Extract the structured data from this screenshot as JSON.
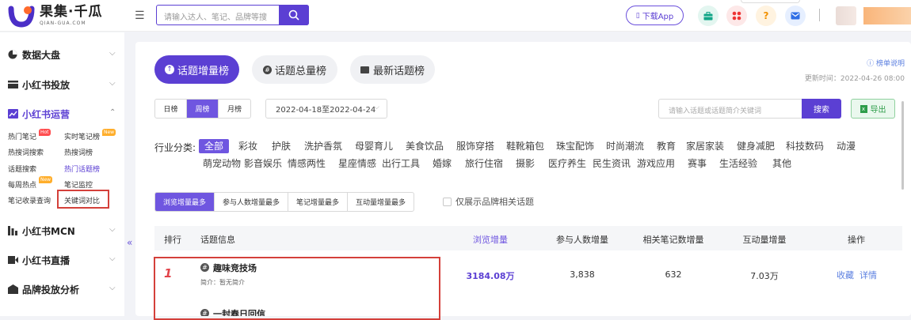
{
  "brand": {
    "name": "果集·千瓜",
    "sub": "QIAN-GUA.COM"
  },
  "topbar": {
    "search_placeholder": "请输入达人、笔记、品牌等搜",
    "download_label": "下载App",
    "icons": [
      "briefcase-icon",
      "apps-icon",
      "help-icon",
      "mail-icon"
    ]
  },
  "sidebar": {
    "sections": [
      {
        "label": "数据大盘",
        "icon": "pie-chart-icon",
        "expanded": false
      },
      {
        "label": "小红书投放",
        "icon": "folder-icon",
        "expanded": false
      },
      {
        "label": "小红书运营",
        "icon": "trend-chart-icon",
        "expanded": true
      },
      {
        "label": "小红书MCN",
        "icon": "mcn-icon",
        "expanded": false
      },
      {
        "label": "小红书直播",
        "icon": "live-icon",
        "expanded": false
      },
      {
        "label": "品牌投放分析",
        "icon": "brand-icon",
        "expanded": false
      }
    ],
    "links": [
      {
        "label": "热门笔记",
        "badge": "Hot"
      },
      {
        "label": "实时笔记榜",
        "badge": "New"
      },
      {
        "label": "热搜词搜索",
        "badge": ""
      },
      {
        "label": "热搜词榜",
        "badge": ""
      },
      {
        "label": "话题搜索",
        "badge": ""
      },
      {
        "label": "热门话题榜",
        "badge": "",
        "active": true
      },
      {
        "label": "每周热点",
        "badge": "New"
      },
      {
        "label": "笔记监控",
        "badge": ""
      },
      {
        "label": "笔记收录查询",
        "badge": ""
      },
      {
        "label": "关键词对比",
        "badge": ""
      }
    ],
    "collapse_glyph": "«"
  },
  "main": {
    "tabs": [
      {
        "label": "话题增量榜",
        "active": true
      },
      {
        "label": "话题总量榜",
        "active": false
      },
      {
        "label": "最新话题榜",
        "active": false
      }
    ],
    "rule_link": "榜单说明",
    "update_time": "更新时间：2022-04-26 08:00",
    "period_tabs": [
      {
        "label": "日榜"
      },
      {
        "label": "周榜",
        "active": true
      },
      {
        "label": "月榜"
      }
    ],
    "date_range": "2022-04-18至2022-04-24",
    "keyword_placeholder": "请输入话题或话题简介关键词",
    "search_label": "搜索",
    "export_label": "导出",
    "industry_label": "行业分类:",
    "industries_row1": [
      "全部",
      "彩妆",
      "护肤",
      "洗护香氛",
      "母婴育儿",
      "美食饮品",
      "服饰穿搭",
      "鞋靴箱包",
      "珠宝配饰",
      "时尚潮流",
      "教育",
      "家居家装",
      "健身减肥",
      "科技数码",
      "动漫"
    ],
    "industries_row2": [
      "萌宠动物",
      "影音娱乐",
      "情感两性",
      "星座情感",
      "出行工具",
      "婚嫁",
      "旅行住宿",
      "摄影",
      "医疗养生",
      "民生资讯",
      "游戏应用",
      "赛事",
      "生活经验",
      "其他"
    ],
    "sort_tabs": [
      {
        "label": "浏览增量最多",
        "active": true
      },
      {
        "label": "参与人数增量最多"
      },
      {
        "label": "笔记增量最多"
      },
      {
        "label": "互动量增量最多"
      }
    ],
    "brand_filter_label": "仅展示品牌相关话题",
    "table": {
      "headers": [
        "排行",
        "话题信息",
        "浏览增量",
        "参与人数增量",
        "相关笔记数增量",
        "互动量增量",
        "操作"
      ],
      "rows": [
        {
          "rank": "1",
          "name": "趣味竞技场",
          "desc": "简介：暂无简介",
          "views": "3184.08万",
          "participants": "3,838",
          "notes": "632",
          "interactions": "7.03万",
          "fav": "收藏",
          "detail": "详情"
        },
        {
          "rank": "",
          "name": "一封春日回信",
          "desc": "",
          "views": "",
          "participants": "",
          "notes": "",
          "interactions": "",
          "fav": "",
          "detail": ""
        }
      ]
    }
  },
  "colors": {
    "accent": "#5b3fd3",
    "rank": "#e2434a",
    "link": "#5b7fe0"
  }
}
